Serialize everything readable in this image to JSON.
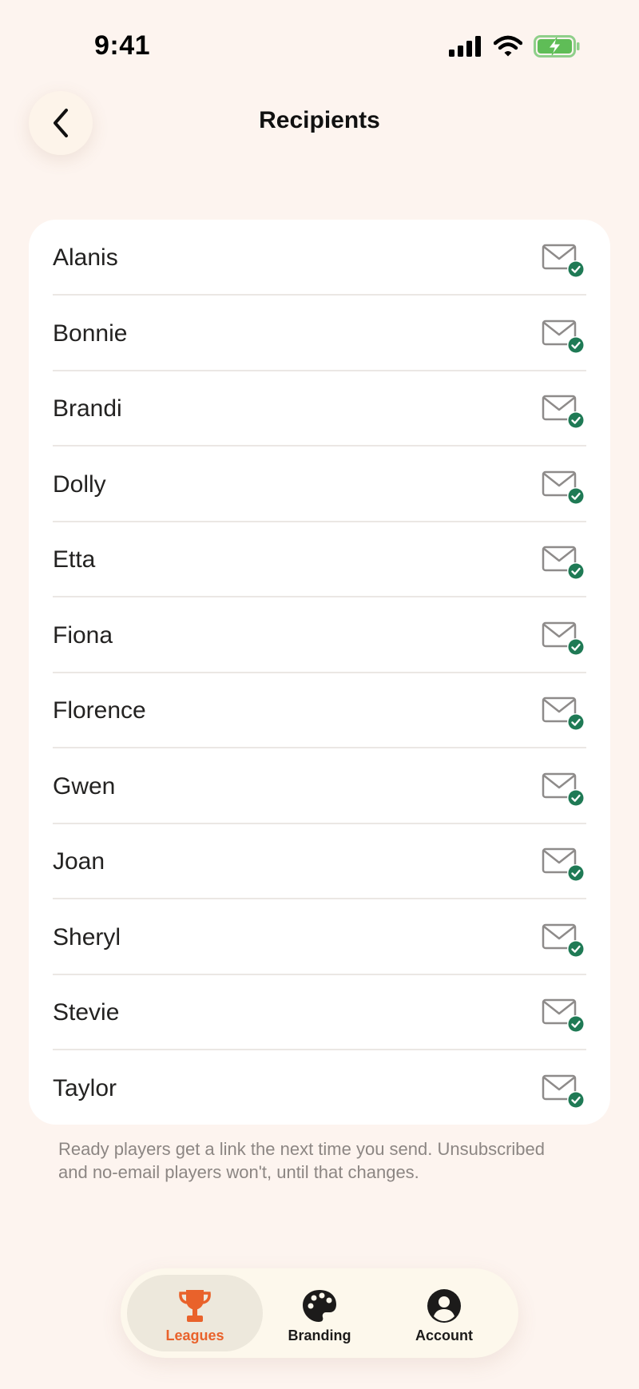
{
  "status_bar": {
    "time": "9:41"
  },
  "header": {
    "title": "Recipients"
  },
  "recipients": [
    {
      "name": "Alanis",
      "status_icon": "mail-check-icon"
    },
    {
      "name": "Bonnie",
      "status_icon": "mail-check-icon"
    },
    {
      "name": "Brandi",
      "status_icon": "mail-check-icon"
    },
    {
      "name": "Dolly",
      "status_icon": "mail-check-icon"
    },
    {
      "name": "Etta",
      "status_icon": "mail-check-icon"
    },
    {
      "name": "Fiona",
      "status_icon": "mail-check-icon"
    },
    {
      "name": "Florence",
      "status_icon": "mail-check-icon"
    },
    {
      "name": "Gwen",
      "status_icon": "mail-check-icon"
    },
    {
      "name": "Joan",
      "status_icon": "mail-check-icon"
    },
    {
      "name": "Sheryl",
      "status_icon": "mail-check-icon"
    },
    {
      "name": "Stevie",
      "status_icon": "mail-check-icon"
    },
    {
      "name": "Taylor",
      "status_icon": "mail-check-icon"
    }
  ],
  "footnote": "Ready players get a link the next time you send. Unsubscribed and no-email players won't, until that changes.",
  "tab_bar": {
    "tabs": [
      {
        "label": "Leagues",
        "icon": "trophy-icon",
        "active": true
      },
      {
        "label": "Branding",
        "icon": "palette-icon",
        "active": false
      },
      {
        "label": "Account",
        "icon": "account-icon",
        "active": false
      }
    ]
  },
  "colors": {
    "background": "#fdf4ef",
    "card": "#ffffff",
    "accent": "#e9622b",
    "check_badge": "#1f7a55"
  }
}
